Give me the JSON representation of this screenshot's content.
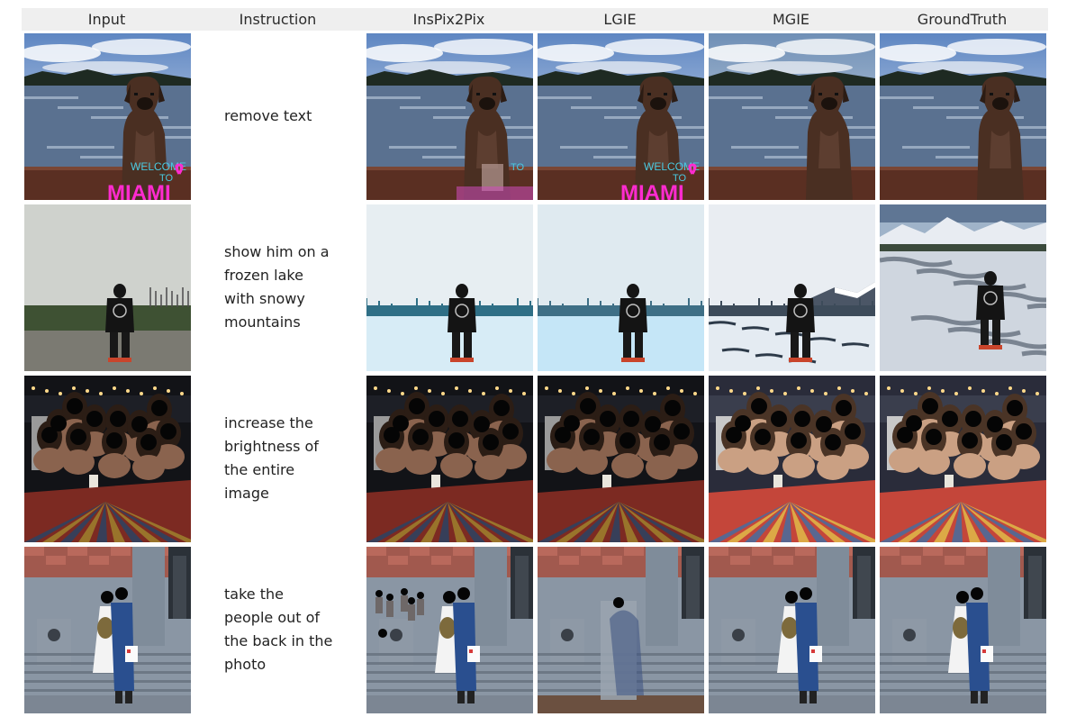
{
  "headers": [
    "Input",
    "Instruction",
    "InsPix2Pix",
    "LGIE",
    "MGIE",
    "GroundTruth"
  ],
  "rows": [
    {
      "scene": "dog-lake",
      "instruction_lines": [
        "remove text"
      ]
    },
    {
      "scene": "man-field",
      "instruction_lines": [
        "show him on a",
        "frozen lake",
        "with snowy",
        "mountains"
      ]
    },
    {
      "scene": "group-bar",
      "instruction_lines": [
        "increase the",
        "brightness of",
        "the entire",
        "image"
      ]
    },
    {
      "scene": "couple-steps",
      "instruction_lines": [
        "take the",
        "people out of",
        "the back in the",
        "photo"
      ]
    }
  ],
  "image_text": {
    "welcome": "WELCOME",
    "to": "TO",
    "miami": "MIAMI"
  }
}
